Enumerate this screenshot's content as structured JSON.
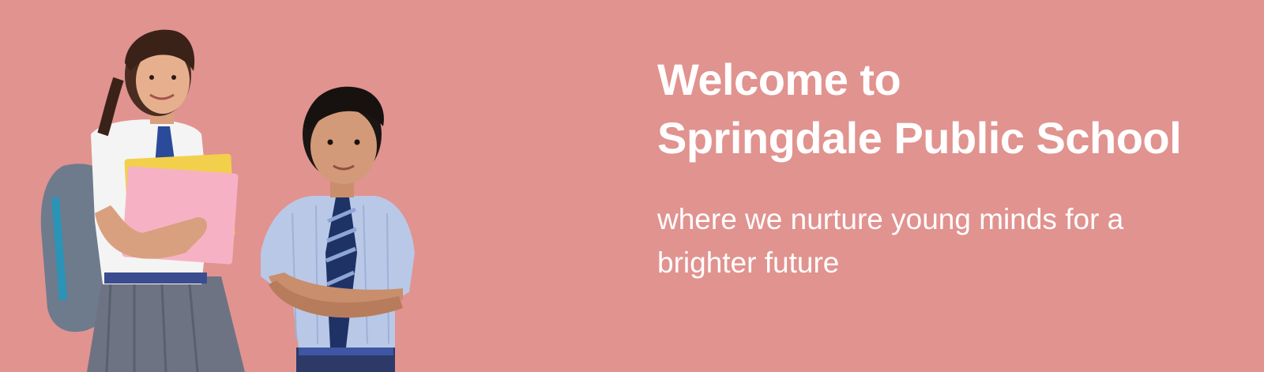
{
  "hero": {
    "title_line1": "Welcome to",
    "title_line2": "Springdale Public School",
    "tagline": "where we nurture young minds for a brighter future",
    "background_color": "#e1938f",
    "text_color": "#ffffff",
    "image": {
      "icon": "students-photo",
      "subjects": [
        "girl-student-with-backpack-and-books",
        "boy-student-with-arms-crossed"
      ]
    }
  }
}
